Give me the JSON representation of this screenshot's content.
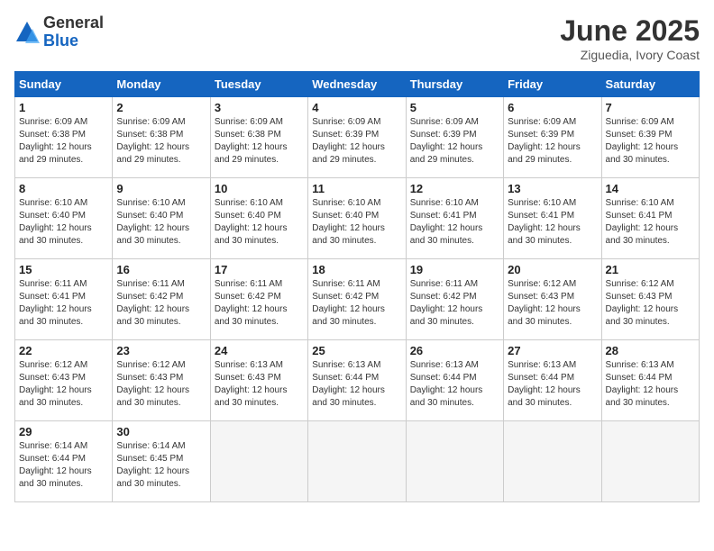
{
  "header": {
    "logo_general": "General",
    "logo_blue": "Blue",
    "month_title": "June 2025",
    "subtitle": "Ziguedia, Ivory Coast"
  },
  "weekdays": [
    "Sunday",
    "Monday",
    "Tuesday",
    "Wednesday",
    "Thursday",
    "Friday",
    "Saturday"
  ],
  "weeks": [
    [
      {
        "day": "1",
        "sunrise": "6:09 AM",
        "sunset": "6:38 PM",
        "daylight": "12 hours and 29 minutes."
      },
      {
        "day": "2",
        "sunrise": "6:09 AM",
        "sunset": "6:38 PM",
        "daylight": "12 hours and 29 minutes."
      },
      {
        "day": "3",
        "sunrise": "6:09 AM",
        "sunset": "6:38 PM",
        "daylight": "12 hours and 29 minutes."
      },
      {
        "day": "4",
        "sunrise": "6:09 AM",
        "sunset": "6:39 PM",
        "daylight": "12 hours and 29 minutes."
      },
      {
        "day": "5",
        "sunrise": "6:09 AM",
        "sunset": "6:39 PM",
        "daylight": "12 hours and 29 minutes."
      },
      {
        "day": "6",
        "sunrise": "6:09 AM",
        "sunset": "6:39 PM",
        "daylight": "12 hours and 29 minutes."
      },
      {
        "day": "7",
        "sunrise": "6:09 AM",
        "sunset": "6:39 PM",
        "daylight": "12 hours and 30 minutes."
      }
    ],
    [
      {
        "day": "8",
        "sunrise": "6:10 AM",
        "sunset": "6:40 PM",
        "daylight": "12 hours and 30 minutes."
      },
      {
        "day": "9",
        "sunrise": "6:10 AM",
        "sunset": "6:40 PM",
        "daylight": "12 hours and 30 minutes."
      },
      {
        "day": "10",
        "sunrise": "6:10 AM",
        "sunset": "6:40 PM",
        "daylight": "12 hours and 30 minutes."
      },
      {
        "day": "11",
        "sunrise": "6:10 AM",
        "sunset": "6:40 PM",
        "daylight": "12 hours and 30 minutes."
      },
      {
        "day": "12",
        "sunrise": "6:10 AM",
        "sunset": "6:41 PM",
        "daylight": "12 hours and 30 minutes."
      },
      {
        "day": "13",
        "sunrise": "6:10 AM",
        "sunset": "6:41 PM",
        "daylight": "12 hours and 30 minutes."
      },
      {
        "day": "14",
        "sunrise": "6:10 AM",
        "sunset": "6:41 PM",
        "daylight": "12 hours and 30 minutes."
      }
    ],
    [
      {
        "day": "15",
        "sunrise": "6:11 AM",
        "sunset": "6:41 PM",
        "daylight": "12 hours and 30 minutes."
      },
      {
        "day": "16",
        "sunrise": "6:11 AM",
        "sunset": "6:42 PM",
        "daylight": "12 hours and 30 minutes."
      },
      {
        "day": "17",
        "sunrise": "6:11 AM",
        "sunset": "6:42 PM",
        "daylight": "12 hours and 30 minutes."
      },
      {
        "day": "18",
        "sunrise": "6:11 AM",
        "sunset": "6:42 PM",
        "daylight": "12 hours and 30 minutes."
      },
      {
        "day": "19",
        "sunrise": "6:11 AM",
        "sunset": "6:42 PM",
        "daylight": "12 hours and 30 minutes."
      },
      {
        "day": "20",
        "sunrise": "6:12 AM",
        "sunset": "6:43 PM",
        "daylight": "12 hours and 30 minutes."
      },
      {
        "day": "21",
        "sunrise": "6:12 AM",
        "sunset": "6:43 PM",
        "daylight": "12 hours and 30 minutes."
      }
    ],
    [
      {
        "day": "22",
        "sunrise": "6:12 AM",
        "sunset": "6:43 PM",
        "daylight": "12 hours and 30 minutes."
      },
      {
        "day": "23",
        "sunrise": "6:12 AM",
        "sunset": "6:43 PM",
        "daylight": "12 hours and 30 minutes."
      },
      {
        "day": "24",
        "sunrise": "6:13 AM",
        "sunset": "6:43 PM",
        "daylight": "12 hours and 30 minutes."
      },
      {
        "day": "25",
        "sunrise": "6:13 AM",
        "sunset": "6:44 PM",
        "daylight": "12 hours and 30 minutes."
      },
      {
        "day": "26",
        "sunrise": "6:13 AM",
        "sunset": "6:44 PM",
        "daylight": "12 hours and 30 minutes."
      },
      {
        "day": "27",
        "sunrise": "6:13 AM",
        "sunset": "6:44 PM",
        "daylight": "12 hours and 30 minutes."
      },
      {
        "day": "28",
        "sunrise": "6:13 AM",
        "sunset": "6:44 PM",
        "daylight": "12 hours and 30 minutes."
      }
    ],
    [
      {
        "day": "29",
        "sunrise": "6:14 AM",
        "sunset": "6:44 PM",
        "daylight": "12 hours and 30 minutes."
      },
      {
        "day": "30",
        "sunrise": "6:14 AM",
        "sunset": "6:45 PM",
        "daylight": "12 hours and 30 minutes."
      },
      null,
      null,
      null,
      null,
      null
    ]
  ]
}
